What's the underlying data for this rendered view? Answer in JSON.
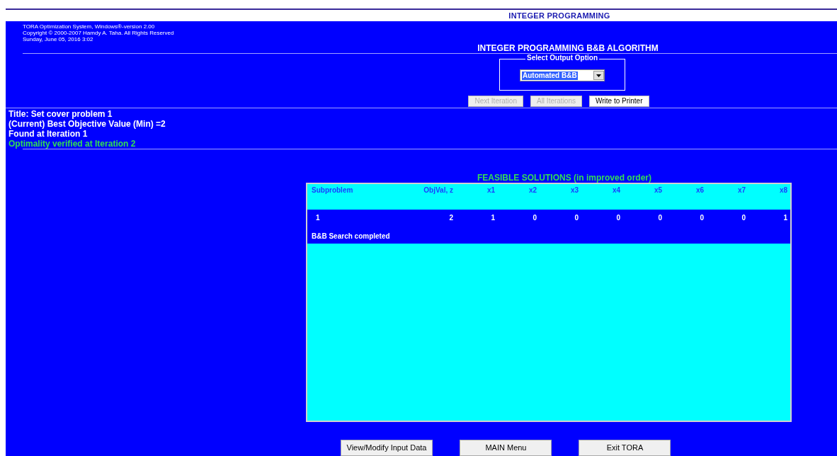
{
  "window": {
    "title": "INTEGER PROGRAMMING"
  },
  "header": {
    "lines": [
      "TORA Optimization System, Windows®-version 2.00",
      "Copyright © 2000-2007 Hamdy A. Taha.  All Rights Reserved",
      "Sunday, June 05, 2016 3:02"
    ],
    "heading": "INTEGER PROGRAMMING B&B ALGORITHM"
  },
  "output_option": {
    "label": "Select Output Option",
    "value": "Automated B&B"
  },
  "action_buttons": [
    {
      "label": "Next Iteration",
      "disabled": true
    },
    {
      "label": "All Iterations",
      "disabled": true
    },
    {
      "label": "Write to Printer",
      "disabled": false
    }
  ],
  "summary": [
    {
      "text": "Title: Set cover problem 1",
      "kind": "info"
    },
    {
      "text": "(Current) Best Objective Value (Min) =2",
      "kind": "info"
    },
    {
      "text": "Found at Iteration 1",
      "kind": "info"
    },
    {
      "text": "Optimality verified at Iteration 2",
      "kind": "success"
    }
  ],
  "table": {
    "title": "FEASIBLE SOLUTIONS (in improved order)",
    "columns": [
      "Subproblem",
      "ObjVal, z",
      "x1",
      "x2",
      "x3",
      "x4",
      "x5",
      "x6",
      "x7",
      "x8"
    ],
    "rows": [
      [
        "1",
        "2",
        "1",
        "0",
        "0",
        "0",
        "0",
        "0",
        "0",
        "1"
      ]
    ],
    "status": "B&B Search completed"
  },
  "bottom_buttons": [
    "View/Modify Input Data",
    "MAIN Menu",
    "Exit TORA"
  ]
}
